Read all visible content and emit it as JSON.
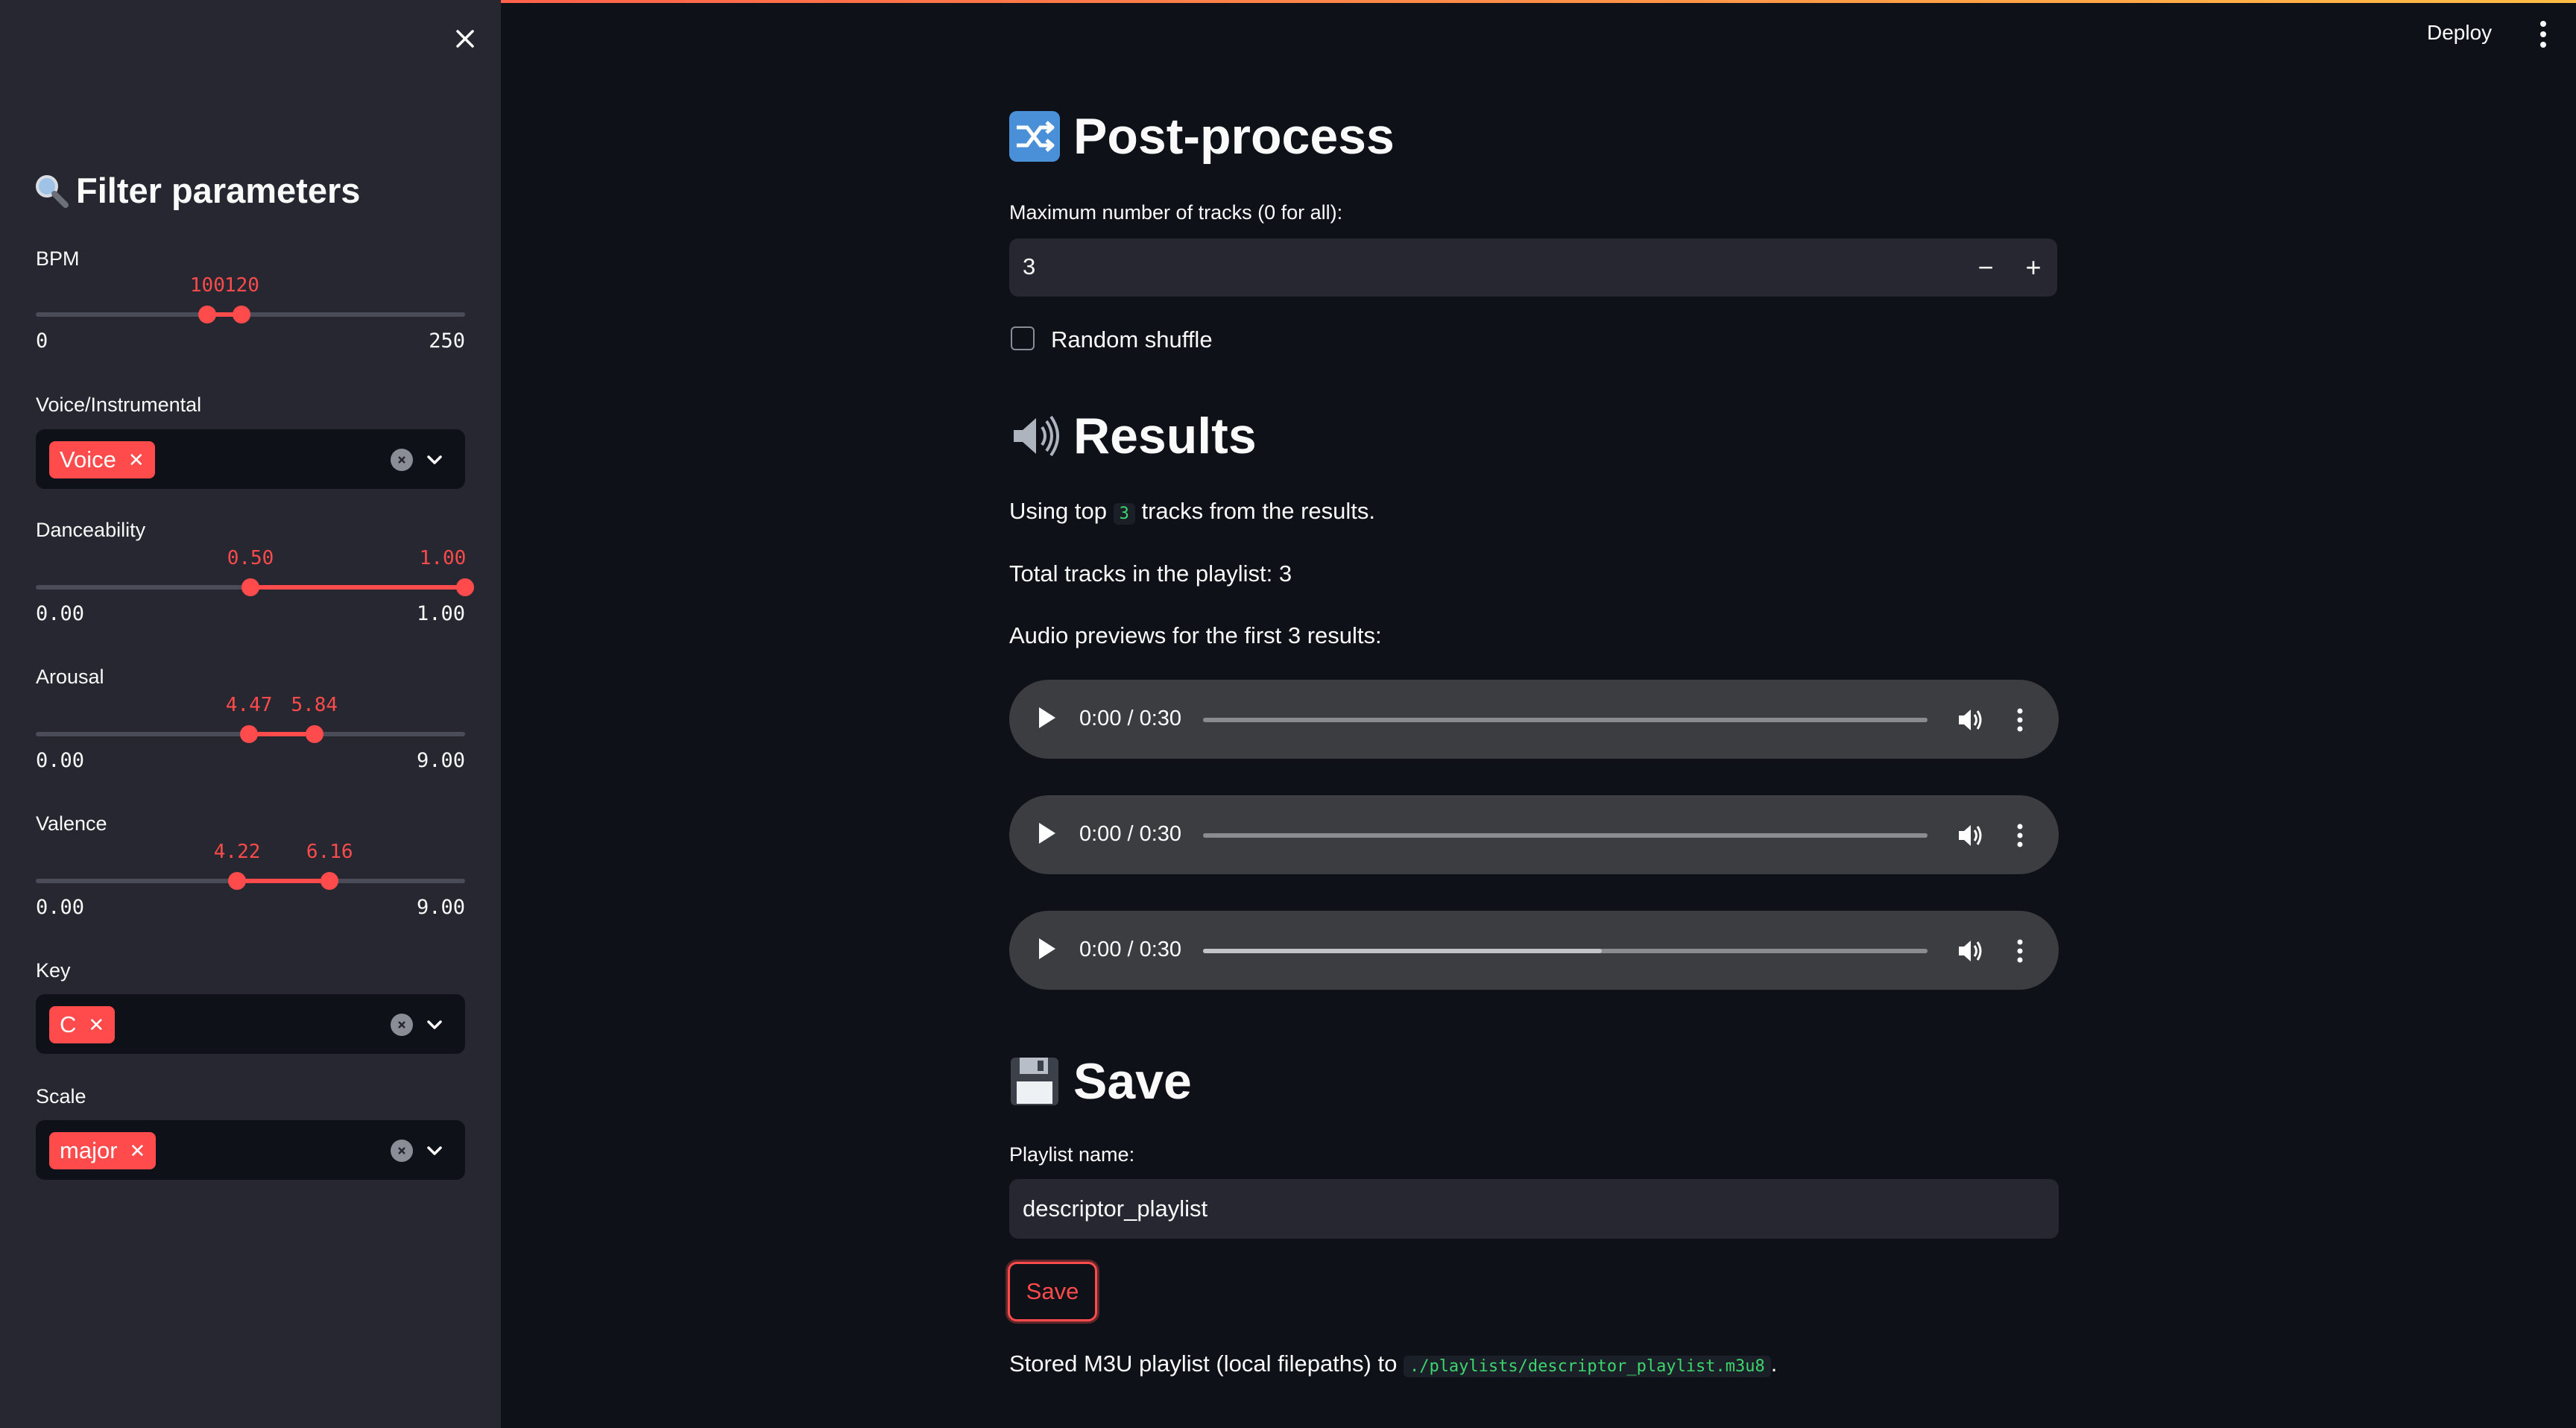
{
  "colors": {
    "accent": "#ff4b4b",
    "background": "#0e1117",
    "sidebar": "#262730",
    "code_text": "#3dd56d"
  },
  "sidebar": {
    "title": "Filter parameters",
    "title_icon": "magnifier-icon",
    "bpm": {
      "label": "BPM",
      "low": "100",
      "high": "120",
      "min": "0",
      "max": "250",
      "low_value": 100,
      "high_value": 120,
      "range": [
        0,
        250
      ]
    },
    "voice": {
      "label": "Voice/Instrumental",
      "chips": [
        "Voice"
      ]
    },
    "danceability": {
      "label": "Danceability",
      "low": "0.50",
      "high": "1.00",
      "min": "0.00",
      "max": "1.00",
      "low_value": 0.5,
      "high_value": 1.0,
      "range": [
        0,
        1
      ]
    },
    "arousal": {
      "label": "Arousal",
      "low": "4.47",
      "high": "5.84",
      "min": "0.00",
      "max": "9.00",
      "low_value": 4.47,
      "high_value": 5.84,
      "range": [
        0,
        9
      ]
    },
    "valence": {
      "label": "Valence",
      "low": "4.22",
      "high": "6.16",
      "min": "0.00",
      "max": "9.00",
      "low_value": 4.22,
      "high_value": 6.16,
      "range": [
        0,
        9
      ]
    },
    "key": {
      "label": "Key",
      "chips": [
        "C"
      ]
    },
    "scale": {
      "label": "Scale",
      "chips": [
        "major"
      ]
    }
  },
  "header": {
    "deploy_label": "Deploy"
  },
  "postprocess": {
    "title": "Post-process",
    "icon": "shuffle-icon",
    "max_tracks_label": "Maximum number of tracks (0 for all):",
    "max_tracks_value": "3",
    "random_shuffle_label": "Random shuffle",
    "random_shuffle_checked": false
  },
  "results": {
    "title": "Results",
    "icon": "speaker-icon",
    "using_top_prefix": "Using top",
    "using_top_value": "3",
    "using_top_suffix": "tracks from the results.",
    "total_tracks": "Total tracks in the playlist: 3",
    "previews_label": "Audio previews for the first 3 results:",
    "players": [
      {
        "time": "0:00 / 0:30",
        "buffered": 0
      },
      {
        "time": "0:00 / 0:30",
        "buffered": 0
      },
      {
        "time": "0:00 / 0:30",
        "buffered": 0.55
      }
    ]
  },
  "save": {
    "title": "Save",
    "icon": "floppy-disk-icon",
    "name_label": "Playlist name:",
    "name_value": "descriptor_playlist",
    "button_label": "Save",
    "stored_prefix": "Stored M3U playlist (local filepaths) to",
    "stored_path": "./playlists/descriptor_playlist.m3u8",
    "stored_suffix": "."
  }
}
